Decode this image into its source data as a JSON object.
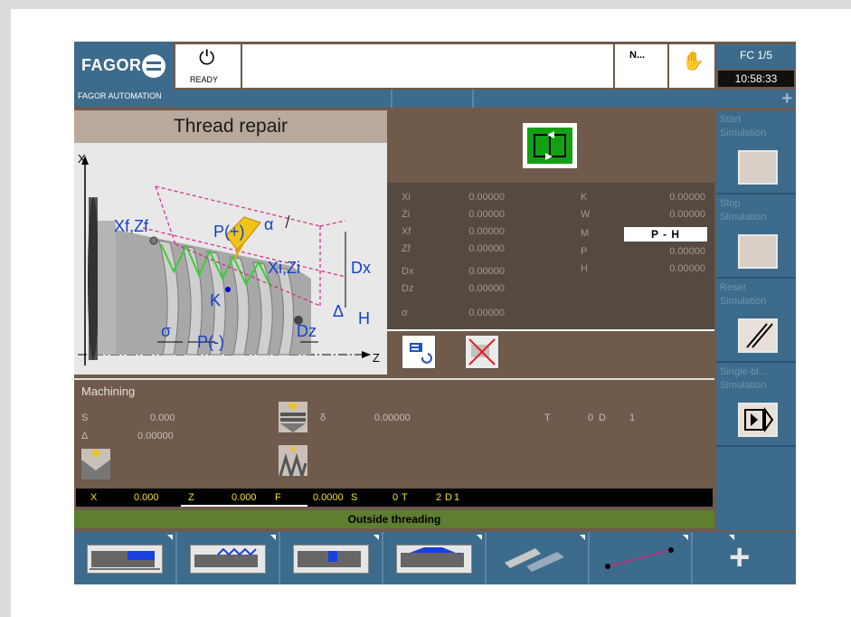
{
  "header": {
    "brand": "FAGOR",
    "brand_sub": "FAGOR AUTOMATION",
    "status": "READY",
    "n_label": "N...",
    "fc_label": "FC 1/5",
    "clock": "10:58:33"
  },
  "cycle": {
    "title": "Thread repair"
  },
  "diagram_labels": {
    "x_axis": "X",
    "z_axis": "Z",
    "xf_zf": "Xf,Zf",
    "xi_zi": "Xi,Zi",
    "p_plus": "P(+)",
    "p_minus": "P(-)",
    "alpha": "α",
    "dx": "Dx",
    "dz": "Dz",
    "k": "K",
    "sigma": "σ",
    "delta": "Δ",
    "h": "H"
  },
  "params_left": [
    {
      "label": "Xi",
      "value": "0.00000"
    },
    {
      "label": "Zi",
      "value": "0.00000"
    },
    {
      "label": "Xf",
      "value": "0.00000"
    },
    {
      "label": "Zf",
      "value": "0.00000"
    },
    {
      "label": "Dx",
      "value": "0.00000"
    },
    {
      "label": "Dz",
      "value": "0.00000"
    },
    {
      "label": "σ",
      "value": "0.00000"
    }
  ],
  "params_right": [
    {
      "label": "K",
      "value": "0.00000"
    },
    {
      "label": "W",
      "value": "0.00000"
    },
    {
      "label": "M",
      "value": "P - H"
    },
    {
      "label": "P",
      "value": "0.00000"
    },
    {
      "label": "H",
      "value": "0.00000"
    }
  ],
  "softkeys_right": [
    {
      "label": "Start\nSimulation",
      "icon": "start-simulation-icon"
    },
    {
      "label": "Stop\nSimulation",
      "icon": "stop-simulation-icon"
    },
    {
      "label": "Reset\nSimulation",
      "icon": "reset-simulation-icon"
    },
    {
      "label": "Single-bl...\nSimulation",
      "icon": "single-block-icon"
    }
  ],
  "machining": {
    "title": "Machining",
    "s_label": "S",
    "s_value": "0.000",
    "delta_label": "Δ",
    "delta_value": "0.00000",
    "small_delta_label": "δ",
    "small_delta_value": "0.00000",
    "t_label": "T",
    "t_value": "0",
    "d_label": "D",
    "d_value": "1"
  },
  "statusbar": {
    "x_label": "X",
    "x_value": "0.000",
    "z_label": "Z",
    "z_value": "0.000",
    "f_label": "F",
    "f_value": "0.0000",
    "s_label": "S",
    "s_value": "0",
    "t_label": "T",
    "t_value": "2",
    "d_label": "D",
    "d_value": "1"
  },
  "option_bar": "Outside threading",
  "bottom_softkeys": [
    {
      "icon": "turning-icon"
    },
    {
      "icon": "threading-icon"
    },
    {
      "icon": "grooving-icon"
    },
    {
      "icon": "profile-icon"
    },
    {
      "icon": "drilling-icon"
    },
    {
      "icon": "positioning-icon"
    },
    {
      "icon": "plus-icon"
    }
  ],
  "colors": {
    "panel_blue": "#3d6b8b",
    "panel_brown": "#6f5a4b",
    "accent_green": "#14a014",
    "status_yellow": "#f0e020"
  }
}
